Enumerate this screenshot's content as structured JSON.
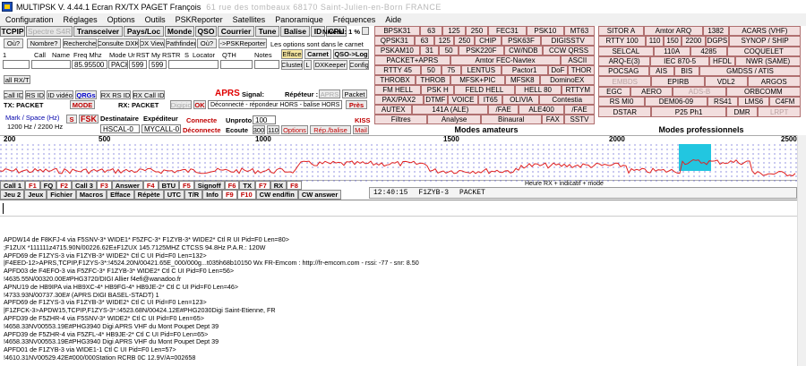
{
  "window": {
    "title": "MULTIPSK V. 4.44.1 Ecran RX/TX  PAGET François",
    "title_blurred": "61 rue des tombeaux  68170 Saint-Julien-en-Born  FRANCE"
  },
  "menu": [
    "Configuration",
    "Réglages",
    "Options",
    "Outils",
    "PSKReporter",
    "Satellites",
    "Panoramique",
    "Fréquences",
    "Aide"
  ],
  "toolbar": [
    "TCPIP",
    "Spectre S4R",
    "Transceiver",
    "Pays/Loc",
    "Monde",
    "QSO",
    "Courrier",
    "Tune",
    "Balise",
    "ID",
    "CPU"
  ],
  "niveau": "Niveau: 1 %",
  "row2": {
    "ou": "Où?",
    "nombre": "Nombre?",
    "recherche": "Recherche",
    "consulte": "Consulte DXK",
    "dxview": "DX View",
    "pathfinder": "Pathfinder",
    "ou2": "Où?",
    "pskreporter": "->PSKReporter",
    "notice": "Les options sont dans le carnet"
  },
  "log_header": {
    "n": "1",
    "call": "Call",
    "name": "Name",
    "freq": "Freq Mhz",
    "mode_ur": "Mode Ur",
    "rst": "RST My RST",
    "r": "R",
    "s": "S",
    "locator": "Locator",
    "qth": "QTH",
    "notes": "Notes",
    "efface": "Efface",
    "carnet": "Carnet",
    "qso_log": "QSO->Log",
    "freq_value": "85.95500",
    "mode_value": "PACK",
    "rst_value": "599",
    "myrst_value": "599",
    "cluster": "Cluster",
    "l": "L",
    "dxkeeper": "DXKeeper",
    "config": "Config"
  },
  "aprs_tab": "Call RX/TX",
  "row_ids": {
    "callid": "Call ID",
    "rsid": "RS ID",
    "idvideo": "ID vidéo",
    "qrgs": "QRGs",
    "rxrsid": "RX RS ID",
    "rxcallid": "RX Call ID",
    "aprs": "APRS",
    "signal": "Signal:",
    "repeteur": "Répéteur :",
    "aprs2": "APRS",
    "packet": "Packet",
    "txpacket": "TX: PACKET",
    "mode": "MODE",
    "rxpacket": "RX: PACKET",
    "digipic": "Digipic",
    "ok": "OK",
    "deconnecte": "Déconnecté - répondeur HORS - balise HORS",
    "pres": "Près"
  },
  "mark": {
    "label": "Mark / Space (Hz)",
    "value": "1200 Hz / 2200 Hz",
    "s": "S",
    "fsk": "FSK",
    "destinataire": "Destinataire",
    "expediteur": "Expéditeur",
    "dest_value": "HSCAL-0",
    "exp_value": "MYCALL-0",
    "connecte": "Connecte",
    "unproto": "Unproto",
    "unproto_value": "100",
    "deconnecte": "Déconnecte",
    "ecoute": "Ecoute",
    "baud300": "300",
    "baud110": "110",
    "options": "Options",
    "repbalise": "Rép./balise",
    "mail": "Mail",
    "kiss": "KISS"
  },
  "modes_amateurs": {
    "title": "Modes amateurs",
    "cells": [
      [
        "BPSK31",
        "63",
        "125",
        "250",
        "FEC31",
        "PSK10",
        "MT63"
      ],
      [
        "QPSK31",
        "63",
        "125",
        "250",
        "CHIP",
        "PSK63F",
        "DIGISSTV"
      ],
      [
        "PSKAM10",
        "31",
        "50",
        "PSK220F",
        "CW/NDB",
        "CCW QRSS"
      ],
      [
        "PACKET+APRS",
        "Amtor FEC-Navtex",
        "ASCII"
      ],
      [
        "RTTY 45",
        "50",
        "75",
        "LENTUS",
        "Pactor1",
        "DoF",
        "THOR"
      ],
      [
        "THROBX",
        "THROB",
        "MFSK+PIC",
        "MFSK8",
        "DominoEX"
      ],
      [
        "FM HELL",
        "PSK H",
        "FELD HELL",
        "HELL 80",
        "RTTYM"
      ],
      [
        "PAX/PAX2",
        "DTMF",
        "VOICE",
        "IT65",
        "OLIVIA",
        "Contestia"
      ],
      [
        "AUTEX",
        "141A (ALE)",
        "/FAE",
        "ALE400",
        "/FAE"
      ],
      [
        "Filtres",
        "Analyse",
        "Binaural",
        "FAX",
        "SSTV"
      ]
    ]
  },
  "modes_professionnels": {
    "title": "Modes professionnels",
    "cells": [
      [
        "SITOR A",
        "Amtor ARQ",
        "1382",
        "ACARS (VHF)"
      ],
      [
        "RTTY 100",
        "110",
        "150",
        "2200",
        "DGPS",
        "SYNOP / SHIP"
      ],
      [
        "SELCAL",
        "110A",
        "4285",
        "COQUELET"
      ],
      [
        "ARQ-E(3)",
        "IEC 870-5",
        "HFDL",
        "NWR (SAME)"
      ],
      [
        "POCSAG",
        "AIS",
        "BIS",
        "GMDSS / ATIS"
      ],
      [
        "EMBDS",
        "EPIRB",
        "VDL2",
        "ARGOS"
      ],
      [
        "EGC",
        "AERO",
        "ADS-B",
        "ORBCOMM"
      ],
      [
        "RS MI0",
        "DEM06-09",
        "RS41",
        "LMS6",
        "C4FM"
      ],
      [
        "DSTAR",
        "P25 Ph1",
        "DMR",
        "LRPT"
      ]
    ]
  },
  "scale": [
    "200",
    "500",
    "1000",
    "1500",
    "2000",
    "2500"
  ],
  "bottom_left": {
    "row1": [
      "Call 1",
      "F1",
      "FQ",
      "F2",
      "Call 3",
      "F3",
      "Answer",
      "F4",
      "BTU",
      "F5",
      "Signoff",
      "F6",
      "TX",
      "F7",
      "RX",
      "F8"
    ],
    "row2": [
      "Jeu 2",
      "Jeux",
      "Fichier",
      "Macros",
      "Efface",
      "Répète",
      "UTC",
      "T/R",
      "Info",
      "F9",
      "F10",
      "CW end/fin",
      "CW answer"
    ]
  },
  "heard": {
    "label": "Heure RX + indicatif + mode",
    "time": "12:40:15",
    "call": "F1ZYB-3",
    "mode": "PACKET"
  },
  "log_lines": [
    "APDW14 de F8KFJ-4 via F5SNV-3* WIDE1* F5ZFC-3* F1ZYB-3* WIDE2* Ctl R UI Pid=F0 Len=80>",
    ";F1ZUX    *111111z4715.90N/00226.62E±F1ZUX 145.7125MHZ CTCSS 94.8Hz P.A.R.: 120W",
    "APFD69 de F1ZYS-3 via F1ZYB-3* WIDE2* Ctl C UI Pid=F0 Len=132>",
    "|F4EED-12>APRS,TCPIP,F1ZYS-3*:!4524.20N/00421.65E_000/000g...t035h68b10150 Wx FR-Emcom : http://fr-emcom.com - rssi: -77 - snr: 8.50",
    "APFD03 de F4EFO-3 via F5ZFC-3* F1ZYB-3* WIDE2* Ctl C UI Pid=F0 Len=56>",
    "!4635.55N/00320.00E#PHG3720/DIGI Allier f4efi@wanadoo.fr",
    "APNU19 de HB9IPA via HB9XC-4* HB9FG-4* HB9JE-2* Ctl C UI Pid=F0 Len=46>",
    "!4733.93N/00737.30E# (APRS DIGI BASEL-STADT) 1",
    "APFD69 de F1ZYS-3 via F1ZYB-3* WIDE2* Ctl C UI Pid=F0 Len=123>",
    "|F1ZFCK-3>APDW15,TCPIP,F1ZYS-3*:!4523.68N/00424.12E#PHG2030Digi Saint-Etienne, FR",
    "APFD39 de F5ZHR-4 via F5SNV-3* WIDE2* Ctl C UI Pid=F0 Len=65>",
    "!4658.33NV00553.19E#PHG3940 Digi APRS VHF du Mont Poupet Dept 39",
    "APFD39 de F5ZHR-4 via F5ZFL-4* HB9JE-2* Ctl C UI Pid=F0 Len=65>",
    "!4658.33NV00553.19E#PHG3940 Digi APRS VHF du Mont Poupet Dept 39",
    "APFD01 de F1ZYB-3 via WIDE1-1 Ctl C UI Pid=F0 Len=57>",
    "!4610.31NV00529.42E#000/000Station RCRB 0C 12.9V/A=002658"
  ]
}
